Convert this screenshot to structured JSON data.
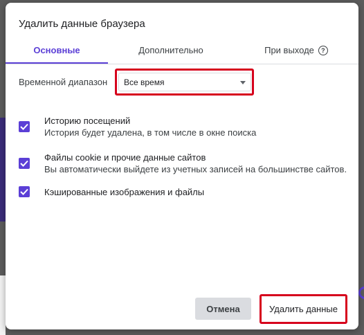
{
  "dialog": {
    "title": "Удалить данные браузера"
  },
  "tabs": [
    {
      "label": "Основные",
      "active": true
    },
    {
      "label": "Дополнительно",
      "active": false
    },
    {
      "label": "При выходе",
      "active": false,
      "icon": "help-icon",
      "icon_glyph": "?"
    }
  ],
  "time_range": {
    "label": "Временной диапазон",
    "selected": "Все время"
  },
  "options": [
    {
      "title": "Историю посещений",
      "description": "История будет удалена, в том числе в окне поиска",
      "checked": true
    },
    {
      "title": "Файлы cookie и прочие данные сайтов",
      "description": "Вы автоматически выйдете из учетных записей на большинстве сайтов.",
      "checked": true
    },
    {
      "title": "Кэшированные изображения и файлы",
      "description": "",
      "checked": true
    }
  ],
  "buttons": {
    "cancel": "Отмена",
    "delete": "Удалить данные"
  },
  "colors": {
    "accent": "#5b3fd6",
    "highlight": "#d6001c"
  }
}
